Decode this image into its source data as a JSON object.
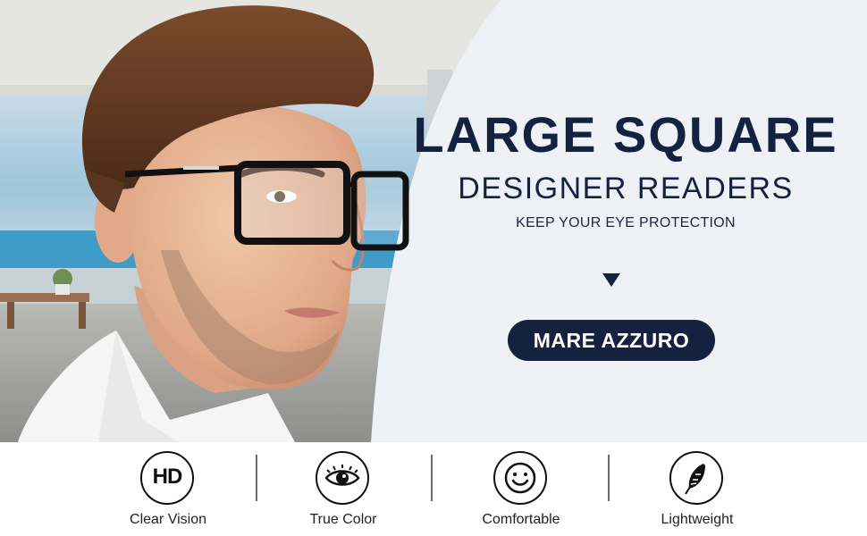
{
  "hero": {
    "headline": "LARGE SQUARE",
    "subheadline": "DESIGNER READERS",
    "tagline": "KEEP YOUR EYE PROTECTION",
    "brand_button": "MARE AZZURO"
  },
  "features": [
    {
      "label": "Clear Vision",
      "icon": "hd-icon",
      "icon_text": "HD"
    },
    {
      "label": "True Color",
      "icon": "eye-icon"
    },
    {
      "label": "Comfortable",
      "icon": "smiley-icon"
    },
    {
      "label": "Lightweight",
      "icon": "feather-icon"
    }
  ],
  "colors": {
    "navy": "#15223f",
    "panel_bg": "#eef2f7",
    "sea": "#3f9bc8"
  }
}
